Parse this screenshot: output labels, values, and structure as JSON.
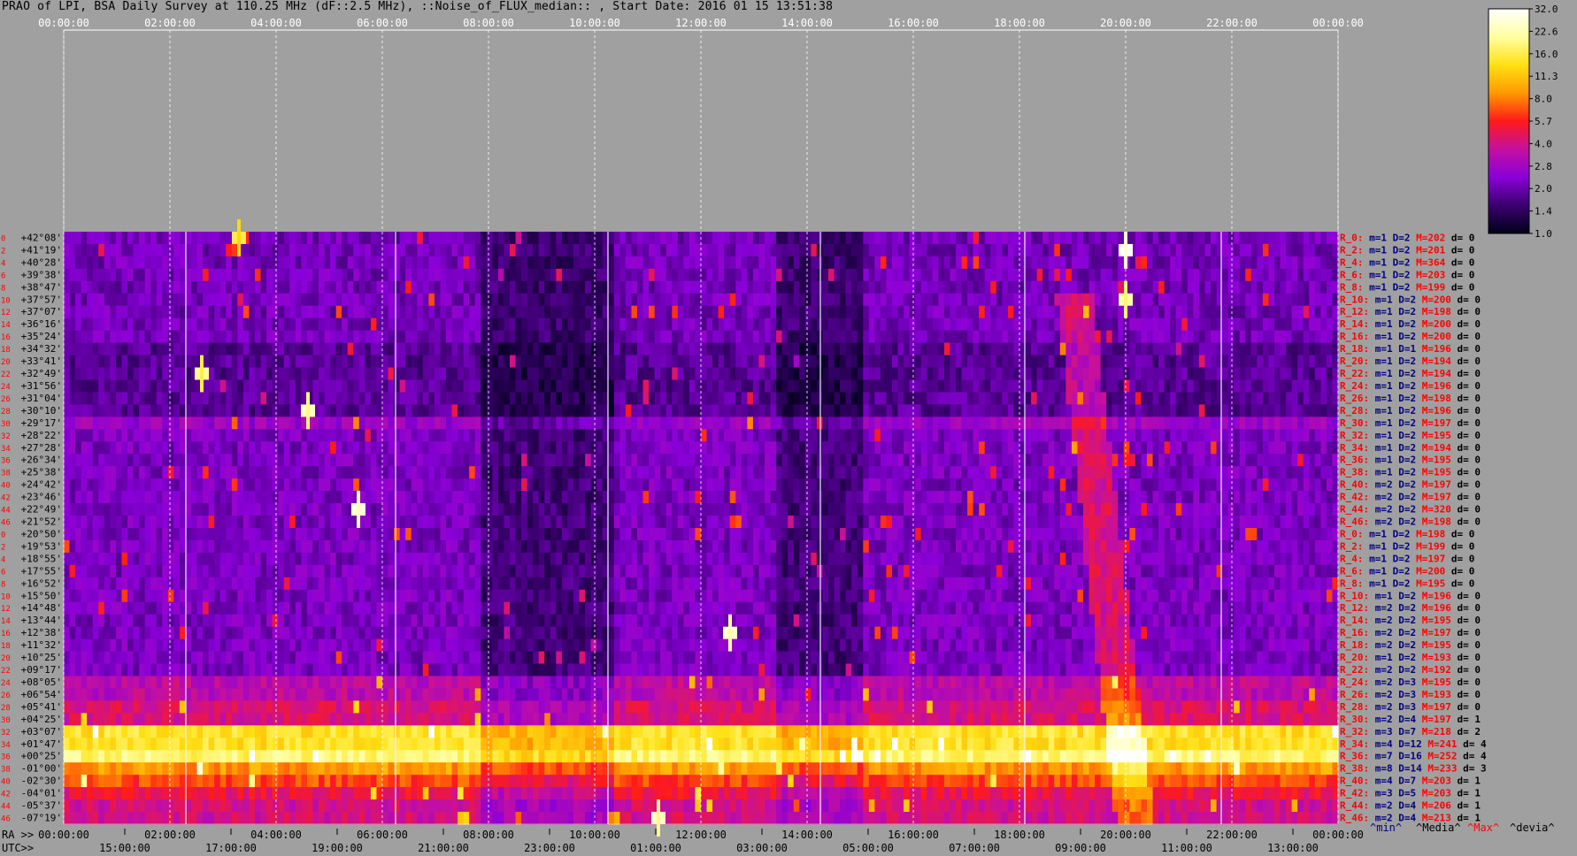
{
  "title": "PRAO of LPI, BSA Daily Survey at 110.25 MHz (dF::2.5 MHz), ::Noise_of_FLUX_median:: , Start Date: 2016 01 15 13:51:38",
  "colors": {
    "background": "#a0a0a0",
    "grid": "#ffffff",
    "dec_label": "#000000",
    "row_num": "#ff0000",
    "stat_prefix": "#ff0000",
    "stat_min": "#000080",
    "stat_max": "#ff0000",
    "stat_dev": "#000000"
  },
  "chart_data": {
    "type": "heatmap",
    "title": "PRAO of LPI, BSA Daily Survey at 110.25 MHz (dF::2.5 MHz), ::Noise_of_FLUX_median:: , Start Date: 2016 01 15 13:51:38",
    "top_time_labels": [
      "00:00:00",
      "02:00:00",
      "04:00:00",
      "06:00:00",
      "08:00:00",
      "10:00:00",
      "12:00:00",
      "14:00:00",
      "16:00:00",
      "18:00:00",
      "20:00:00",
      "22:00:00",
      "00:00:00"
    ],
    "ra_prefix": "RA >>",
    "utc_prefix": "UTC>>",
    "ra_labels": [
      "00:00:00",
      "02:00:00",
      "04:00:00",
      "06:00:00",
      "08:00:00",
      "10:00:00",
      "12:00:00",
      "14:00:00",
      "16:00:00",
      "18:00:00",
      "20:00:00",
      "22:00:00",
      "00:00:00"
    ],
    "utc_labels": [
      "15:00:00",
      "17:00:00",
      "19:00:00",
      "21:00:00",
      "23:00:00",
      "01:00:00",
      "03:00:00",
      "05:00:00",
      "07:00:00",
      "09:00:00",
      "11:00:00",
      "13:00:00"
    ],
    "declinations": [
      "+42°08'",
      "+41°19'",
      "+40°28'",
      "+39°38'",
      "+38°47'",
      "+37°57'",
      "+37°07'",
      "+36°16'",
      "+35°24'",
      "+34°32'",
      "+33°41'",
      "+32°49'",
      "+31°56'",
      "+31°04'",
      "+30°10'",
      "+29°17'",
      "+28°22'",
      "+27°28'",
      "+26°34'",
      "+25°38'",
      "+24°42'",
      "+23°46'",
      "+22°49'",
      "+21°52'",
      "+20°50'",
      "+19°53'",
      "+18°55'",
      "+17°55'",
      "+16°52'",
      "+15°50'",
      "+14°48'",
      "+13°44'",
      "+12°38'",
      "+11°32'",
      "+10°25'",
      "+09°17'",
      "+08°05'",
      "+06°54'",
      "+05°41'",
      "+04°25'",
      "+03°07'",
      "+01°47'",
      "+00°25'",
      "-01°00'",
      "-02°30'",
      "-04°01'",
      "-05°37'",
      "-07°19'"
    ],
    "row_numbers": [
      "0",
      "2",
      "4",
      "6",
      "8",
      "10",
      "12",
      "14",
      "16",
      "18",
      "20",
      "22",
      "24",
      "26",
      "28",
      "30",
      "32",
      "34",
      "36",
      "38",
      "40",
      "42",
      "44",
      "46",
      "0",
      "2",
      "4",
      "6",
      "8",
      "10",
      "12",
      "14",
      "16",
      "18",
      "20",
      "22",
      "24",
      "26",
      "28",
      "30",
      "32",
      "34",
      "36",
      "38",
      "40",
      "42",
      "44",
      "46"
    ],
    "stats": [
      {
        "r": "R_0:",
        "m": "m=1",
        "d": "D=2",
        "x": "M=202",
        "v": "d= 0"
      },
      {
        "r": "R_2:",
        "m": "m=1",
        "d": "D=2",
        "x": "M=201",
        "v": "d= 0"
      },
      {
        "r": "R_4:",
        "m": "m=1",
        "d": "D=2",
        "x": "M=364",
        "v": "d= 0"
      },
      {
        "r": "R_6:",
        "m": "m=1",
        "d": "D=2",
        "x": "M=203",
        "v": "d= 0"
      },
      {
        "r": "R_8:",
        "m": "m=1",
        "d": "D=2",
        "x": "M=199",
        "v": "d= 0"
      },
      {
        "r": "R_10:",
        "m": "m=1",
        "d": "D=2",
        "x": "M=200",
        "v": "d= 0"
      },
      {
        "r": "R_12:",
        "m": "m=1",
        "d": "D=2",
        "x": "M=198",
        "v": "d= 0"
      },
      {
        "r": "R_14:",
        "m": "m=1",
        "d": "D=2",
        "x": "M=200",
        "v": "d= 0"
      },
      {
        "r": "R_16:",
        "m": "m=1",
        "d": "D=2",
        "x": "M=200",
        "v": "d= 0"
      },
      {
        "r": "R_18:",
        "m": "m=1",
        "d": "D=1",
        "x": "M=196",
        "v": "d= 0"
      },
      {
        "r": "R_20:",
        "m": "m=1",
        "d": "D=2",
        "x": "M=194",
        "v": "d= 0"
      },
      {
        "r": "R_22:",
        "m": "m=1",
        "d": "D=2",
        "x": "M=194",
        "v": "d= 0"
      },
      {
        "r": "R_24:",
        "m": "m=1",
        "d": "D=2",
        "x": "M=196",
        "v": "d= 0"
      },
      {
        "r": "R_26:",
        "m": "m=1",
        "d": "D=2",
        "x": "M=198",
        "v": "d= 0"
      },
      {
        "r": "R_28:",
        "m": "m=1",
        "d": "D=2",
        "x": "M=196",
        "v": "d= 0"
      },
      {
        "r": "R_30:",
        "m": "m=1",
        "d": "D=2",
        "x": "M=197",
        "v": "d= 0"
      },
      {
        "r": "R_32:",
        "m": "m=1",
        "d": "D=2",
        "x": "M=195",
        "v": "d= 0"
      },
      {
        "r": "R_34:",
        "m": "m=1",
        "d": "D=2",
        "x": "M=194",
        "v": "d= 0"
      },
      {
        "r": "R_36:",
        "m": "m=1",
        "d": "D=2",
        "x": "M=195",
        "v": "d= 0"
      },
      {
        "r": "R_38:",
        "m": "m=1",
        "d": "D=2",
        "x": "M=195",
        "v": "d= 0"
      },
      {
        "r": "R_40:",
        "m": "m=2",
        "d": "D=2",
        "x": "M=197",
        "v": "d= 0"
      },
      {
        "r": "R_42:",
        "m": "m=2",
        "d": "D=2",
        "x": "M=197",
        "v": "d= 0"
      },
      {
        "r": "R_44:",
        "m": "m=2",
        "d": "D=2",
        "x": "M=320",
        "v": "d= 0"
      },
      {
        "r": "R_46:",
        "m": "m=2",
        "d": "D=2",
        "x": "M=198",
        "v": "d= 0"
      },
      {
        "r": "R_0:",
        "m": "m=1",
        "d": "D=2",
        "x": "M=198",
        "v": "d= 0"
      },
      {
        "r": "R_2:",
        "m": "m=1",
        "d": "D=2",
        "x": "M=199",
        "v": "d= 0"
      },
      {
        "r": "R_4:",
        "m": "m=1",
        "d": "D=2",
        "x": "M=197",
        "v": "d= 0"
      },
      {
        "r": "R_6:",
        "m": "m=1",
        "d": "D=2",
        "x": "M=200",
        "v": "d= 0"
      },
      {
        "r": "R_8:",
        "m": "m=1",
        "d": "D=2",
        "x": "M=195",
        "v": "d= 0"
      },
      {
        "r": "R_10:",
        "m": "m=1",
        "d": "D=2",
        "x": "M=196",
        "v": "d= 0"
      },
      {
        "r": "R_12:",
        "m": "m=2",
        "d": "D=2",
        "x": "M=196",
        "v": "d= 0"
      },
      {
        "r": "R_14:",
        "m": "m=2",
        "d": "D=2",
        "x": "M=195",
        "v": "d= 0"
      },
      {
        "r": "R_16:",
        "m": "m=2",
        "d": "D=2",
        "x": "M=197",
        "v": "d= 0"
      },
      {
        "r": "R_18:",
        "m": "m=2",
        "d": "D=2",
        "x": "M=195",
        "v": "d= 0"
      },
      {
        "r": "R_20:",
        "m": "m=1",
        "d": "D=2",
        "x": "M=193",
        "v": "d= 0"
      },
      {
        "r": "R_22:",
        "m": "m=2",
        "d": "D=2",
        "x": "M=192",
        "v": "d= 0"
      },
      {
        "r": "R_24:",
        "m": "m=2",
        "d": "D=3",
        "x": "M=195",
        "v": "d= 0"
      },
      {
        "r": "R_26:",
        "m": "m=2",
        "d": "D=3",
        "x": "M=193",
        "v": "d= 0"
      },
      {
        "r": "R_28:",
        "m": "m=2",
        "d": "D=3",
        "x": "M=197",
        "v": "d= 0"
      },
      {
        "r": "R_30:",
        "m": "m=2",
        "d": "D=4",
        "x": "M=197",
        "v": "d= 1"
      },
      {
        "r": "R_32:",
        "m": "m=3",
        "d": "D=7",
        "x": "M=218",
        "v": "d= 2"
      },
      {
        "r": "R_34:",
        "m": "m=4",
        "d": "D=12",
        "x": "M=241",
        "v": "d= 4"
      },
      {
        "r": "R_36:",
        "m": "m=7",
        "d": "D=16",
        "x": "M=252",
        "v": "d= 4"
      },
      {
        "r": "R_38:",
        "m": "m=8",
        "d": "D=14",
        "x": "M=233",
        "v": "d= 3"
      },
      {
        "r": "R_40:",
        "m": "m=4",
        "d": "D=7",
        "x": "M=203",
        "v": "d= 1"
      },
      {
        "r": "R_42:",
        "m": "m=3",
        "d": "D=5",
        "x": "M=203",
        "v": "d= 1"
      },
      {
        "r": "R_44:",
        "m": "m=2",
        "d": "D=4",
        "x": "M=206",
        "v": "d= 1"
      },
      {
        "r": "R_46:",
        "m": "m=2",
        "d": "D=4",
        "x": "M=213",
        "v": "d= 1"
      }
    ],
    "stats_legend": [
      "^min^",
      "^Media^",
      "^Max^",
      "^devia^"
    ],
    "colorbar_ticks": [
      "32.0",
      "22.6",
      "16.0",
      "11.3",
      "8.0",
      "5.7",
      "4.0",
      "2.8",
      "2.0",
      "1.4",
      "1.0"
    ],
    "colorbar_min": 1.0,
    "colorbar_max": 32.0,
    "colorbar_scale": "log",
    "colormap_stops": [
      "#00001a",
      "#3a006e",
      "#8a00d8",
      "#c410a0",
      "#ff1a1a",
      "#ff9900",
      "#ffe014",
      "#ffffa0",
      "#ffffff"
    ],
    "row_bands": [
      {
        "rows": [
          0,
          8
        ],
        "level": 2.1
      },
      {
        "rows": [
          9,
          14
        ],
        "level": 1.8
      },
      {
        "rows": [
          15,
          15
        ],
        "level": 2.7
      },
      {
        "rows": [
          16,
          23
        ],
        "level": 2.2
      },
      {
        "rows": [
          24,
          35
        ],
        "level": 2.2
      },
      {
        "rows": [
          36,
          37
        ],
        "level": 3.4
      },
      {
        "rows": [
          38,
          39
        ],
        "level": 4.2
      },
      {
        "rows": [
          40,
          41
        ],
        "level": 14.0
      },
      {
        "rows": [
          42,
          42
        ],
        "level": 18.0
      },
      {
        "rows": [
          43,
          43
        ],
        "level": 9.0
      },
      {
        "rows": [
          44,
          44
        ],
        "level": 6.5
      },
      {
        "rows": [
          45,
          45
        ],
        "level": 4.8
      },
      {
        "rows": [
          46,
          47
        ],
        "level": 4.0
      }
    ],
    "dark_time_ranges": [
      [
        7.9,
        10.4
      ],
      [
        13.4,
        15.1
      ]
    ],
    "hot_spots": [
      {
        "time": 20.0,
        "row": 1,
        "value": 32.0
      },
      {
        "time": 20.0,
        "row": 5,
        "value": 22.0
      },
      {
        "time": 5.55,
        "row": 22,
        "value": 28.0
      },
      {
        "time": 12.55,
        "row": 32,
        "value": 26.0
      },
      {
        "time": 2.6,
        "row": 11,
        "value": 20.0
      },
      {
        "time": 4.6,
        "row": 14,
        "value": 24.0
      },
      {
        "time": 3.3,
        "row": 0,
        "value": 16.0
      },
      {
        "time": 11.2,
        "row": 47,
        "value": 24.0
      }
    ],
    "vertical_lines": [
      2.3,
      6.25,
      10.25,
      14.25,
      18.1,
      21.8
    ]
  }
}
